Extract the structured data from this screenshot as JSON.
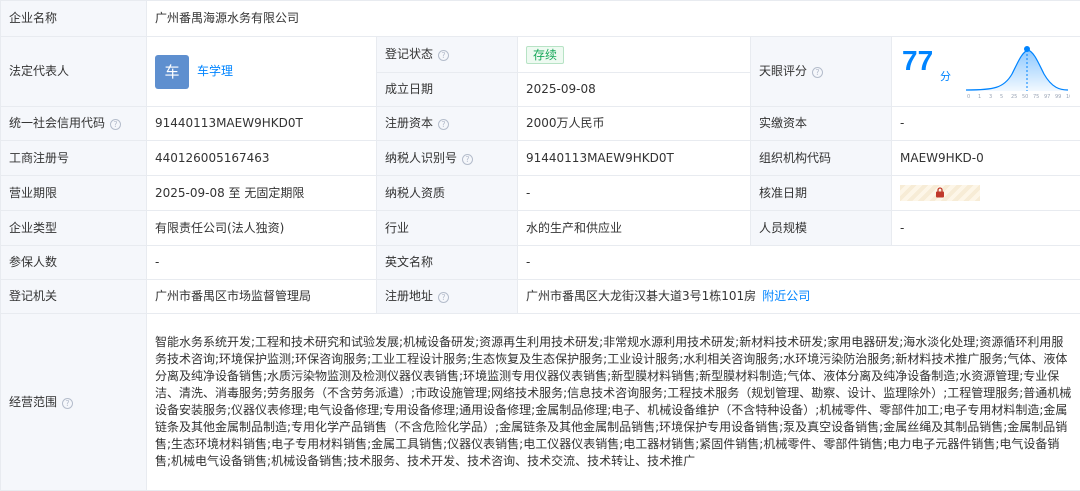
{
  "company_name": {
    "label": "企业名称",
    "value": "广州番禺海源水务有限公司"
  },
  "legal_rep": {
    "label": "法定代表人",
    "avatar_char": "车",
    "name": "车学理"
  },
  "reg_status": {
    "label": "登记状态",
    "value": "存续"
  },
  "est_date": {
    "label": "成立日期",
    "value": "2025-09-08"
  },
  "tianyan": {
    "label": "天眼评分",
    "score": "77",
    "unit": "分",
    "ticks": [
      "0",
      "1",
      "3",
      "5",
      "25",
      "50",
      "75",
      "97",
      "99",
      "100"
    ],
    "accent": "#0084ff"
  },
  "credit_code": {
    "label": "统一社会信用代码",
    "value": "91440113MAEW9HKD0T"
  },
  "reg_capital": {
    "label": "注册资本",
    "value": "2000万人民币"
  },
  "paid_capital": {
    "label": "实缴资本",
    "value": "-"
  },
  "biz_reg_no": {
    "label": "工商注册号",
    "value": "440126005167463"
  },
  "taxpayer_id": {
    "label": "纳税人识别号",
    "value": "91440113MAEW9HKD0T"
  },
  "org_code": {
    "label": "组织机构代码",
    "value": "MAEW9HKD-0"
  },
  "biz_term": {
    "label": "营业期限",
    "value": "2025-09-08 至 无固定期限"
  },
  "taxpayer_qual": {
    "label": "纳税人资质",
    "value": "-"
  },
  "approval_date": {
    "label": "核准日期",
    "icon": "lock-icon"
  },
  "company_type": {
    "label": "企业类型",
    "value": "有限责任公司(法人独资)"
  },
  "industry": {
    "label": "行业",
    "value": "水的生产和供应业"
  },
  "staff_size": {
    "label": "人员规模",
    "value": "-"
  },
  "insured": {
    "label": "参保人数",
    "value": "-"
  },
  "english_name": {
    "label": "英文名称",
    "value": "-"
  },
  "reg_authority": {
    "label": "登记机关",
    "value": "广州市番禺区市场监督管理局"
  },
  "reg_address": {
    "label": "注册地址",
    "value": "广州市番禺区大龙街汉碁大道3号1栋101房",
    "link": "附近公司"
  },
  "biz_scope": {
    "label": "经营范围",
    "value": "智能水务系统开发;工程和技术研究和试验发展;机械设备研发;资源再生利用技术研发;非常规水源利用技术研发;新材料技术研发;家用电器研发;海水淡化处理;资源循环利用服务技术咨询;环境保护监测;环保咨询服务;工业工程设计服务;生态恢复及生态保护服务;工业设计服务;水利相关咨询服务;水环境污染防治服务;新材料技术推广服务;气体、液体分离及纯净设备销售;水质污染物监测及检测仪器仪表销售;环境监测专用仪器仪表销售;新型膜材料销售;新型膜材料制造;气体、液体分离及纯净设备制造;水资源管理;专业保洁、清洗、消毒服务;劳务服务（不含劳务派遣）;市政设施管理;网络技术服务;信息技术咨询服务;工程技术服务（规划管理、勘察、设计、监理除外）;工程管理服务;普通机械设备安装服务;仪器仪表修理;电气设备修理;专用设备修理;通用设备修理;金属制品修理;电子、机械设备维护（不含特种设备）;机械零件、零部件加工;电子专用材料制造;金属链条及其他金属制品制造;专用化学产品销售（不含危险化学品）;金属链条及其他金属制品销售;环境保护专用设备销售;泵及真空设备销售;金属丝绳及其制品销售;金属制品销售;生态环境材料销售;电子专用材料销售;金属工具销售;仪器仪表销售;电工仪器仪表销售;电工器材销售;紧固件销售;机械零件、零部件销售;电力电子元器件销售;电气设备销售;机械电气设备销售;机械设备销售;技术服务、技术开发、技术咨询、技术交流、技术转让、技术推广"
  },
  "help_icon": "question-circle-icon"
}
